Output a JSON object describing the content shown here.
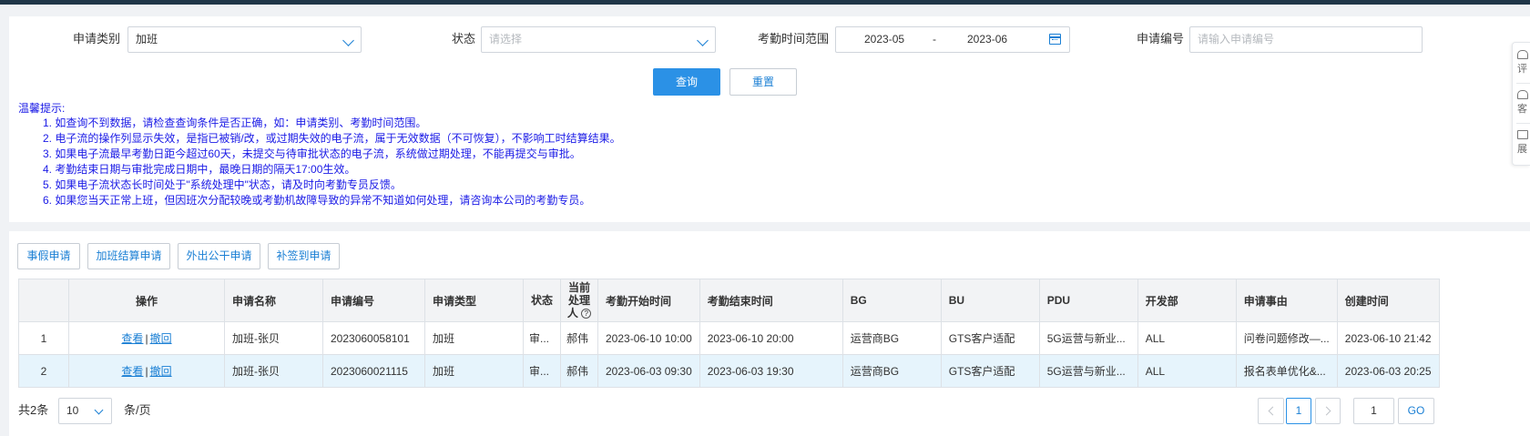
{
  "filters": {
    "type_label": "申请类别",
    "type_value": "加班",
    "status_label": "状态",
    "status_placeholder": "请选择",
    "range_label": "考勤时间范围",
    "range_start": "2023-05",
    "range_sep": "-",
    "range_end": "2023-06",
    "number_label": "申请编号",
    "number_placeholder": "请输入申请编号"
  },
  "buttons": {
    "query": "查询",
    "reset": "重置"
  },
  "tips": {
    "title": "温馨提示:",
    "lines": [
      "1. 如查询不到数据，请检查查询条件是否正确，如：申请类别、考勤时间范围。",
      "2. 电子流的操作列显示失效，是指已被销/改，或过期失效的电子流，属于无效数据（不可恢复），不影响工时结算结果。",
      "3. 如果电子流最早考勤日距今超过60天，未提交与待审批状态的电子流，系统做过期处理，不能再提交与审批。",
      "4. 考勤结束日期与审批完成日期中，最晚日期的隔天17:00生效。",
      "5. 如果电子流状态长时间处于\"系统处理中\"状态，请及时向考勤专员反馈。",
      "6. 如果您当天正常上班，但因班次分配较晚或考勤机故障导致的异常不知道如何处理，请咨询本公司的考勤专员。"
    ]
  },
  "actions": [
    "事假申请",
    "加班结算申请",
    "外出公干申请",
    "补签到申请"
  ],
  "table": {
    "headers": {
      "op": "操作",
      "name": "申请名称",
      "number": "申请编号",
      "type": "申请类型",
      "status": "状态",
      "handler": "当前处理人",
      "start": "考勤开始时间",
      "end": "考勤结束时间",
      "bg": "BG",
      "bu": "BU",
      "pdu": "PDU",
      "dept": "开发部",
      "reason": "申请事由",
      "created": "创建时间"
    },
    "op_view": "查看",
    "op_sep": "|",
    "op_revoke": "撤回",
    "rows": [
      {
        "idx": "1",
        "name": "加班-张贝",
        "number": "2023060058101",
        "type": "加班",
        "status": "审...",
        "handler": "郝伟",
        "start": "2023-06-10 10:00",
        "end": "2023-06-10 20:00",
        "bg": "运营商BG",
        "bu": "GTS客户适配",
        "pdu": "5G运营与新业...",
        "dept": "ALL",
        "reason": "问卷问题修改—...",
        "created": "2023-06-10 21:42"
      },
      {
        "idx": "2",
        "name": "加班-张贝",
        "number": "2023060021115",
        "type": "加班",
        "status": "审...",
        "handler": "郝伟",
        "start": "2023-06-03 09:30",
        "end": "2023-06-03 19:30",
        "bg": "运营商BG",
        "bu": "GTS客户适配",
        "pdu": "5G运营与新业...",
        "dept": "ALL",
        "reason": "报名表单优化&...",
        "created": "2023-06-03 20:25"
      }
    ]
  },
  "pagination": {
    "total": "共2条",
    "page_size": "10",
    "per_page": "条/页",
    "current_page": "1",
    "jump_value": "1",
    "go": "GO"
  },
  "side_tools": [
    "评",
    "客",
    "展"
  ],
  "colors": {
    "primary": "#2b91e6",
    "link": "#1a7fd4",
    "tips_text": "#1a1ae6",
    "row_highlight": "#e6f4fc",
    "topbar": "#203648"
  }
}
